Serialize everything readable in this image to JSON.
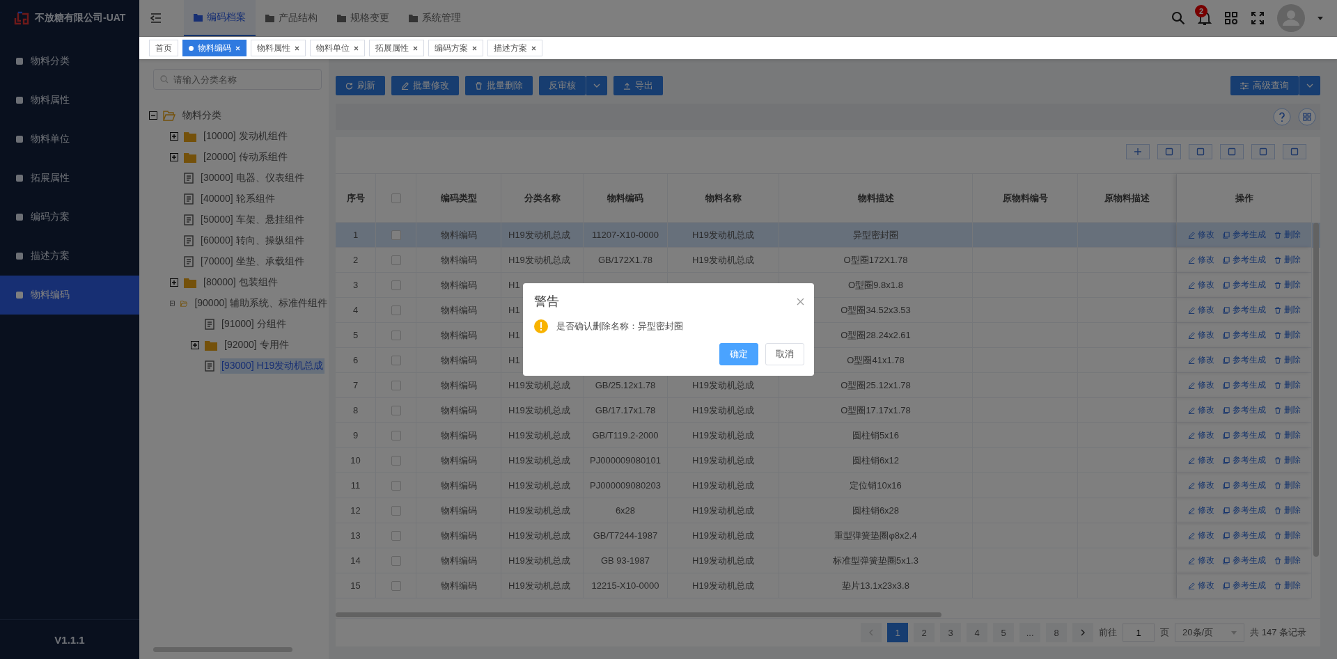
{
  "app": {
    "title": "不放糖有限公司-UAT",
    "version": "V1.1.1"
  },
  "sidebar": {
    "items": [
      {
        "label": "物料分类",
        "selected": false
      },
      {
        "label": "物料属性",
        "selected": false
      },
      {
        "label": "物料单位",
        "selected": false
      },
      {
        "label": "拓展属性",
        "selected": false
      },
      {
        "label": "编码方案",
        "selected": false
      },
      {
        "label": "描述方案",
        "selected": false
      },
      {
        "label": "物料编码",
        "selected": true
      }
    ]
  },
  "top_nav": {
    "items": [
      {
        "label": "编码档案",
        "selected": true
      },
      {
        "label": "产品结构",
        "selected": false
      },
      {
        "label": "规格变更",
        "selected": false
      },
      {
        "label": "系统管理",
        "selected": false
      }
    ]
  },
  "header": {
    "notification_count": "2"
  },
  "page_tabs": [
    {
      "label": "首页",
      "selected": false,
      "closable": false
    },
    {
      "label": "物料编码",
      "selected": true,
      "closable": true
    },
    {
      "label": "物料属性",
      "selected": false,
      "closable": true
    },
    {
      "label": "物料单位",
      "selected": false,
      "closable": true
    },
    {
      "label": "拓展属性",
      "selected": false,
      "closable": true
    },
    {
      "label": "编码方案",
      "selected": false,
      "closable": true
    },
    {
      "label": "描述方案",
      "selected": false,
      "closable": true
    }
  ],
  "tree": {
    "search": {
      "placeholder": "请输入分类名称"
    },
    "nodes": [
      {
        "label": "物料分类",
        "kind": "folder",
        "expanded": true,
        "selected": false,
        "children": [
          {
            "label": "[10000] 发动机组件",
            "kind": "folder",
            "expanded": false,
            "selected": false
          },
          {
            "label": "[20000] 传动系组件",
            "kind": "folder",
            "expanded": false,
            "selected": false
          },
          {
            "label": "[30000] 电器、仪表组件",
            "kind": "leaf",
            "selected": false
          },
          {
            "label": "[40000] 轮系组件",
            "kind": "leaf",
            "selected": false
          },
          {
            "label": "[50000] 车架、悬挂组件",
            "kind": "leaf",
            "selected": false
          },
          {
            "label": "[60000] 转向、操纵组件",
            "kind": "leaf",
            "selected": false
          },
          {
            "label": "[70000] 坐垫、承载组件",
            "kind": "leaf",
            "selected": false
          },
          {
            "label": "[80000] 包装组件",
            "kind": "folder",
            "expanded": false,
            "selected": false
          },
          {
            "label": "[90000] 辅助系统、标准件组件",
            "kind": "folder",
            "expanded": true,
            "selected": false,
            "children": [
              {
                "label": "[91000] 分组件",
                "kind": "leaf",
                "selected": false
              },
              {
                "label": "[92000] 专用件",
                "kind": "folder",
                "expanded": false,
                "selected": false
              },
              {
                "label": "[93000] H19发动机总成",
                "kind": "leaf",
                "selected": true
              }
            ]
          }
        ]
      }
    ]
  },
  "toolbar": {
    "buttons": [
      {
        "label": "刷新",
        "split": false
      },
      {
        "label": "批量修改",
        "split": false
      },
      {
        "label": "批量删除",
        "split": false
      },
      {
        "label": "反审核",
        "split": true
      },
      {
        "label": "导出",
        "split": false
      }
    ],
    "advanced_query": {
      "label": "高级查询",
      "split": true
    }
  },
  "table": {
    "columns": [
      "序号",
      "",
      "编码类型",
      "分类名称",
      "物料编码",
      "物料名称",
      "物料描述",
      "原物料编号",
      "原物料描述",
      "操作"
    ],
    "header_checked": false,
    "rows": [
      {
        "checked": false,
        "selected": true,
        "cells": [
          "1",
          "",
          "物料编码",
          "H19发动机总成",
          "11207-X10-0000",
          "H19发动机总成",
          "异型密封圈"
        ],
        "actions": [
          "修改",
          "参考生成",
          "删除"
        ]
      },
      {
        "checked": false,
        "selected": false,
        "cells": [
          "2",
          "",
          "物料编码",
          "H19发动机总成",
          "GB/172X1.78",
          "H19发动机总成",
          "O型圈172X1.78"
        ],
        "actions": [
          "修改",
          "参考生成",
          "删除"
        ]
      },
      {
        "checked": false,
        "selected": false,
        "cells": [
          "3",
          "",
          "物料编码",
          "H1",
          null,
          null,
          "O型圈9.8x1.8"
        ],
        "actions": [
          "修改",
          "参考生成",
          "删除"
        ]
      },
      {
        "checked": false,
        "selected": false,
        "cells": [
          "4",
          "",
          "物料编码",
          "H1",
          null,
          null,
          "O型圈34.52x3.53"
        ],
        "actions": [
          "修改",
          "参考生成",
          "删除"
        ]
      },
      {
        "checked": false,
        "selected": false,
        "cells": [
          "5",
          "",
          "物料编码",
          "H1",
          null,
          null,
          "O型圈28.24x2.61"
        ],
        "actions": [
          "修改",
          "参考生成",
          "删除"
        ]
      },
      {
        "checked": false,
        "selected": false,
        "cells": [
          "6",
          "",
          "物料编码",
          "H1",
          null,
          null,
          "O型圈41x1.78"
        ],
        "actions": [
          "修改",
          "参考生成",
          "删除"
        ]
      },
      {
        "checked": false,
        "selected": false,
        "cells": [
          "7",
          "",
          "物料编码",
          "H19发动机总成",
          "GB/25.12x1.78",
          "H19发动机总成",
          "O型圈25.12x1.78"
        ],
        "actions": [
          "修改",
          "参考生成",
          "删除"
        ]
      },
      {
        "checked": false,
        "selected": false,
        "cells": [
          "8",
          "",
          "物料编码",
          "H19发动机总成",
          "GB/17.17x1.78",
          "H19发动机总成",
          "O型圈17.17x1.78"
        ],
        "actions": [
          "修改",
          "参考生成",
          "删除"
        ]
      },
      {
        "checked": false,
        "selected": false,
        "cells": [
          "9",
          "",
          "物料编码",
          "H19发动机总成",
          "GB/T119.2-2000",
          "H19发动机总成",
          "圆柱销5x16"
        ],
        "actions": [
          "修改",
          "参考生成",
          "删除"
        ]
      },
      {
        "checked": false,
        "selected": false,
        "cells": [
          "10",
          "",
          "物料编码",
          "H19发动机总成",
          "PJ000009080101",
          "H19发动机总成",
          "圆柱销6x12"
        ],
        "actions": [
          "修改",
          "参考生成",
          "删除"
        ]
      },
      {
        "checked": false,
        "selected": false,
        "cells": [
          "11",
          "",
          "物料编码",
          "H19发动机总成",
          "PJ000009080203",
          "H19发动机总成",
          "定位销10x16"
        ],
        "actions": [
          "修改",
          "参考生成",
          "删除"
        ]
      },
      {
        "checked": false,
        "selected": false,
        "cells": [
          "12",
          "",
          "物料编码",
          "H19发动机总成",
          "6x28",
          "H19发动机总成",
          "圆柱销6x28"
        ],
        "actions": [
          "修改",
          "参考生成",
          "删除"
        ]
      },
      {
        "checked": false,
        "selected": false,
        "cells": [
          "13",
          "",
          "物料编码",
          "H19发动机总成",
          "GB/T7244-1987",
          "H19发动机总成",
          "重型弹簧垫圈φ8x2.4"
        ],
        "actions": [
          "修改",
          "参考生成",
          "删除"
        ]
      },
      {
        "checked": false,
        "selected": false,
        "cells": [
          "14",
          "",
          "物料编码",
          "H19发动机总成",
          "GB 93-1987",
          "H19发动机总成",
          "标准型弹簧垫圈5x1.3"
        ],
        "actions": [
          "修改",
          "参考生成",
          "删除"
        ]
      },
      {
        "checked": false,
        "selected": false,
        "cells": [
          "15",
          "",
          "物料编码",
          "H19发动机总成",
          "12215-X10-0000",
          "H19发动机总成",
          "垫片13.1x23x3.8"
        ],
        "actions": [
          "修改",
          "参考生成",
          "删除"
        ]
      }
    ]
  },
  "pagination": {
    "pages": [
      {
        "label": "1",
        "selected": true
      },
      {
        "label": "2",
        "selected": false
      },
      {
        "label": "3",
        "selected": false
      },
      {
        "label": "4",
        "selected": false
      },
      {
        "label": "5",
        "selected": false
      },
      {
        "label": "...",
        "selected": false
      },
      {
        "label": "8",
        "selected": false
      }
    ],
    "goto_label": "前往",
    "goto_value": "1",
    "page_unit": "页",
    "page_size": "20条/页",
    "total": "共 147 条记录"
  },
  "dialog": {
    "title": "警告",
    "message": "是否确认删除名称：异型密封圈",
    "buttons": [
      {
        "label": "确定",
        "primary": true
      },
      {
        "label": "取消",
        "primary": false
      }
    ]
  }
}
